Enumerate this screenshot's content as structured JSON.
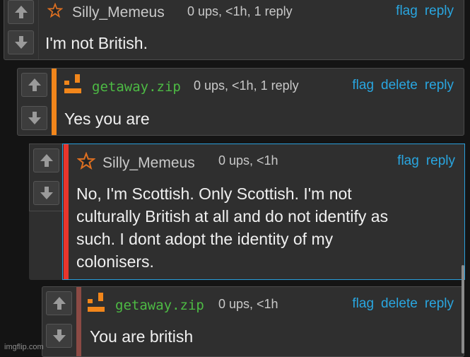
{
  "comments": [
    {
      "username": "Silly_Memeus",
      "meta": "0 ups, <1h, 1 reply",
      "actions": [
        "flag",
        "reply"
      ],
      "body": "I'm not British."
    },
    {
      "username": "getaway.zip",
      "meta": "0 ups, <1h, 1 reply",
      "actions": [
        "flag",
        "delete",
        "reply"
      ],
      "body": "Yes you are",
      "stripe_color": "#f2861b"
    },
    {
      "username": "Silly_Memeus",
      "meta": "0 ups, <1h",
      "actions": [
        "flag",
        "reply"
      ],
      "body_lines": [
        "No, I'm Scottish. Only Scottish. I'm not",
        "culturally British at all and do not identify as",
        "such. I dont adopt the identity of my",
        "colonisers."
      ],
      "stripe_color": "#e8352c",
      "highlight_color": "#2a9fdb"
    },
    {
      "username": "getaway.zip",
      "meta": "0 ups, <1h",
      "actions": [
        "flag",
        "delete",
        "reply"
      ],
      "body": "You are british",
      "stripe_color": "#8b4a44"
    }
  ],
  "icons": {
    "upvote": "up-arrow-icon",
    "downvote": "down-arrow-icon",
    "silly_avatar": "star-avatar-icon",
    "getaway_avatar": "pixel-logo-avatar-icon"
  },
  "watermark": "imgflip.com"
}
